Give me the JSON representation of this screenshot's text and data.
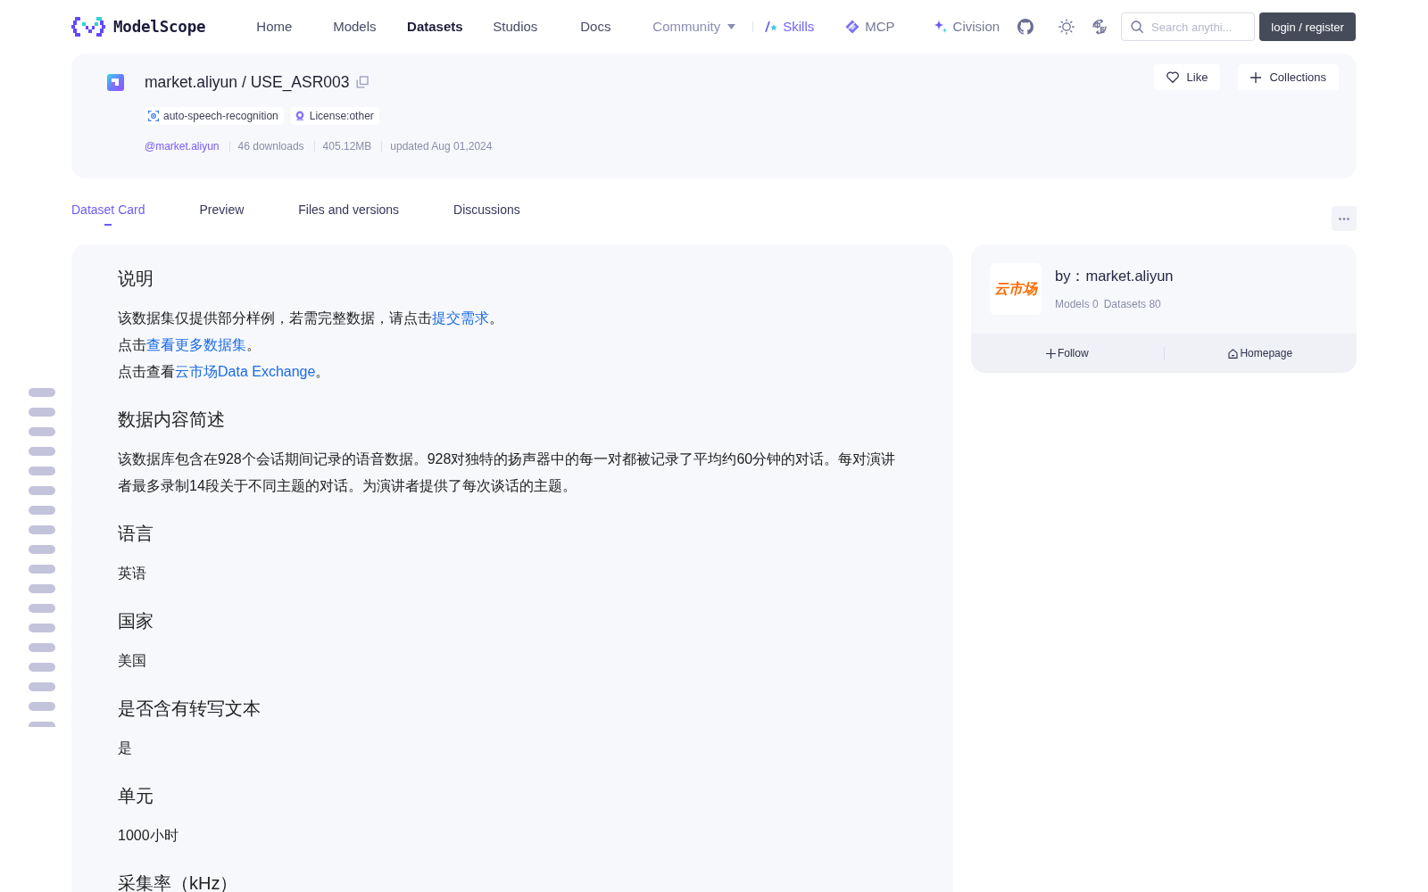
{
  "header": {
    "logo": {
      "wordmark": "ModelScope"
    },
    "nav": [
      {
        "label": "Home",
        "selected": false
      },
      {
        "label": "Models",
        "selected": false
      },
      {
        "label": "Datasets",
        "selected": true
      },
      {
        "label": "Studios",
        "selected": false
      },
      {
        "label": "Docs",
        "selected": false
      }
    ],
    "community": {
      "label": "Community"
    },
    "features": [
      {
        "kind": "skills",
        "label": "Skills"
      },
      {
        "kind": "mcp",
        "label": "MCP"
      },
      {
        "kind": "civision",
        "label": "Civision"
      }
    ],
    "search": {
      "placeholder": "Search anythi..."
    },
    "login_button": {
      "label": "login / register"
    }
  },
  "dataset": {
    "title": "market.aliyun / USE_ASR003",
    "tags": [
      {
        "kind": "task",
        "label": "auto-speech-recognition"
      },
      {
        "kind": "license",
        "label": "License:other"
      }
    ],
    "owner": "@market.aliyun",
    "meta": [
      "46 downloads",
      "405.12MB",
      "updated Aug 01,2024"
    ],
    "actions": [
      {
        "kind": "like",
        "label": "Like"
      },
      {
        "kind": "collect",
        "label": "Collections"
      }
    ]
  },
  "tabs": [
    {
      "label": "Dataset Card",
      "selected": true
    },
    {
      "label": "Preview",
      "selected": false
    },
    {
      "label": "Files and versions",
      "selected": false
    },
    {
      "label": "Discussions",
      "selected": false
    }
  ],
  "content": [
    {
      "kind": "heading",
      "text": "说明"
    },
    {
      "kind": "paragraph",
      "text": "该数据集仅提供部分样例，若需完整数据，请点击",
      "link": "提交需求",
      "after": "。"
    },
    {
      "kind": "paragraph",
      "text": "点击",
      "link": "查看更多数据集",
      "after": "。"
    },
    {
      "kind": "paragraph",
      "text": "点击查看",
      "link": "云市场Data Exchange",
      "after": "。"
    },
    {
      "kind": "heading",
      "text": "数据内容简述"
    },
    {
      "kind": "paragraph",
      "text": "该数据库包含在928个会话期间记录的语音数据。928对独特的扬声器中的每一对都被记录了平均约60分钟的对话。每对演讲者最多录制14段关于不同主题的对话。为演讲者提供了每次谈话的主题。"
    },
    {
      "kind": "heading",
      "text": "语言"
    },
    {
      "kind": "paragraph",
      "text": "英语"
    },
    {
      "kind": "heading",
      "text": "国家"
    },
    {
      "kind": "paragraph",
      "text": "美国"
    },
    {
      "kind": "heading",
      "text": "是否含有转写文本"
    },
    {
      "kind": "paragraph",
      "text": "是"
    },
    {
      "kind": "heading",
      "text": "单元"
    },
    {
      "kind": "paragraph",
      "text": "1000小时"
    },
    {
      "kind": "heading",
      "text": "采集率（kHz）"
    }
  ],
  "owner_card": {
    "avatar_text": "云市场",
    "name": "by：market.aliyun",
    "stats": [
      "Models 0",
      "Datasets 80"
    ],
    "actions": [
      {
        "kind": "follow",
        "label": "Follow"
      },
      {
        "kind": "homepage",
        "label": "Homepage"
      }
    ]
  }
}
